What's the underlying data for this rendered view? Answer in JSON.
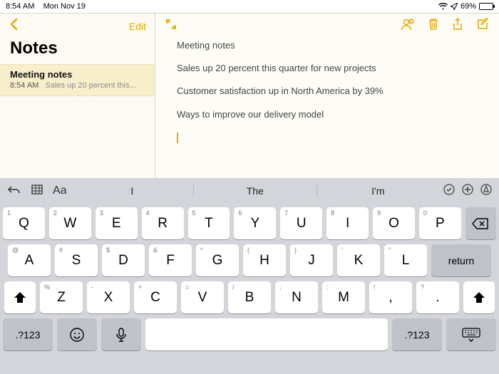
{
  "status": {
    "time": "8:54 AM",
    "date": "Mon Nov 19",
    "battery_pct": "69%"
  },
  "sidebar": {
    "edit_label": "Edit",
    "title": "Notes",
    "item": {
      "title": "Meeting notes",
      "time": "8:54 AM",
      "preview": "Sales up 20 percent this…"
    }
  },
  "note": {
    "l1": "Meeting notes",
    "l2": "Sales up 20 percent this quarter for new projects",
    "l3": "Customer satisfaction up in North America by 39%",
    "l4": "Ways to improve our delivery model"
  },
  "suggest": {
    "w1": "I",
    "w2": "The",
    "w3": "I'm"
  },
  "keys": {
    "r1": [
      {
        "a": "1",
        "m": "Q"
      },
      {
        "a": "2",
        "m": "W"
      },
      {
        "a": "3",
        "m": "E"
      },
      {
        "a": "4",
        "m": "R"
      },
      {
        "a": "5",
        "m": "T"
      },
      {
        "a": "6",
        "m": "Y"
      },
      {
        "a": "7",
        "m": "U"
      },
      {
        "a": "8",
        "m": "I"
      },
      {
        "a": "9",
        "m": "O"
      },
      {
        "a": "0",
        "m": "P"
      }
    ],
    "r2": [
      {
        "a": "@",
        "m": "A"
      },
      {
        "a": "#",
        "m": "S"
      },
      {
        "a": "$",
        "m": "D"
      },
      {
        "a": "&",
        "m": "F"
      },
      {
        "a": "*",
        "m": "G"
      },
      {
        "a": "(",
        "m": "H"
      },
      {
        "a": ")",
        "m": "J"
      },
      {
        "a": "'",
        "m": "K"
      },
      {
        "a": "\"",
        "m": "L"
      }
    ],
    "r3": [
      {
        "a": "%",
        "m": "Z"
      },
      {
        "a": "-",
        "m": "X"
      },
      {
        "a": "+",
        "m": "C"
      },
      {
        "a": "=",
        "m": "V"
      },
      {
        "a": "/",
        "m": "B"
      },
      {
        "a": ";",
        "m": "N"
      },
      {
        "a": ":",
        "m": "M"
      },
      {
        "a": "!",
        "m": ","
      },
      {
        "a": "?",
        "m": "."
      }
    ],
    "return": "return",
    "numkey": ".?123"
  }
}
